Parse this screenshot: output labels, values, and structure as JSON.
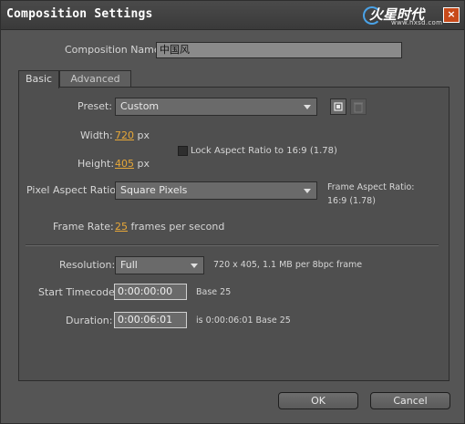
{
  "window": {
    "title": "Composition Settings",
    "watermark": "火星时代",
    "watermark_url": "www.hxsd.com",
    "close_glyph": "×"
  },
  "comp_name": {
    "label": "Composition Name:",
    "value": "中国风"
  },
  "tabs": [
    {
      "label": "Basic",
      "active": true
    },
    {
      "label": "Advanced",
      "active": false
    }
  ],
  "preset": {
    "label": "Preset:",
    "value": "Custom"
  },
  "width": {
    "label": "Width:",
    "value": "720",
    "unit": "px"
  },
  "height": {
    "label": "Height:",
    "value": "405",
    "unit": "px"
  },
  "lock_aspect": {
    "label": "Lock Aspect Ratio to 16:9 (1.78)",
    "checked": false
  },
  "pixel_aspect": {
    "label": "Pixel Aspect Ratio:",
    "value": "Square Pixels"
  },
  "frame_aspect": {
    "label": "Frame Aspect Ratio:",
    "value": "16:9 (1.78)"
  },
  "frame_rate": {
    "label": "Frame Rate:",
    "value": "25",
    "unit": "frames per second"
  },
  "resolution": {
    "label": "Resolution:",
    "value": "Full",
    "info": "720 x 405, 1.1 MB per 8bpc frame"
  },
  "start_timecode": {
    "label": "Start Timecode:",
    "value": "0:00:00:00",
    "base": "Base 25"
  },
  "duration": {
    "label": "Duration:",
    "value": "0:00:06:01",
    "info": "is 0:00:06:01  Base 25"
  },
  "buttons": {
    "ok": "OK",
    "cancel": "Cancel"
  },
  "colors": {
    "accent": "#e8a838",
    "background": "#555555"
  }
}
